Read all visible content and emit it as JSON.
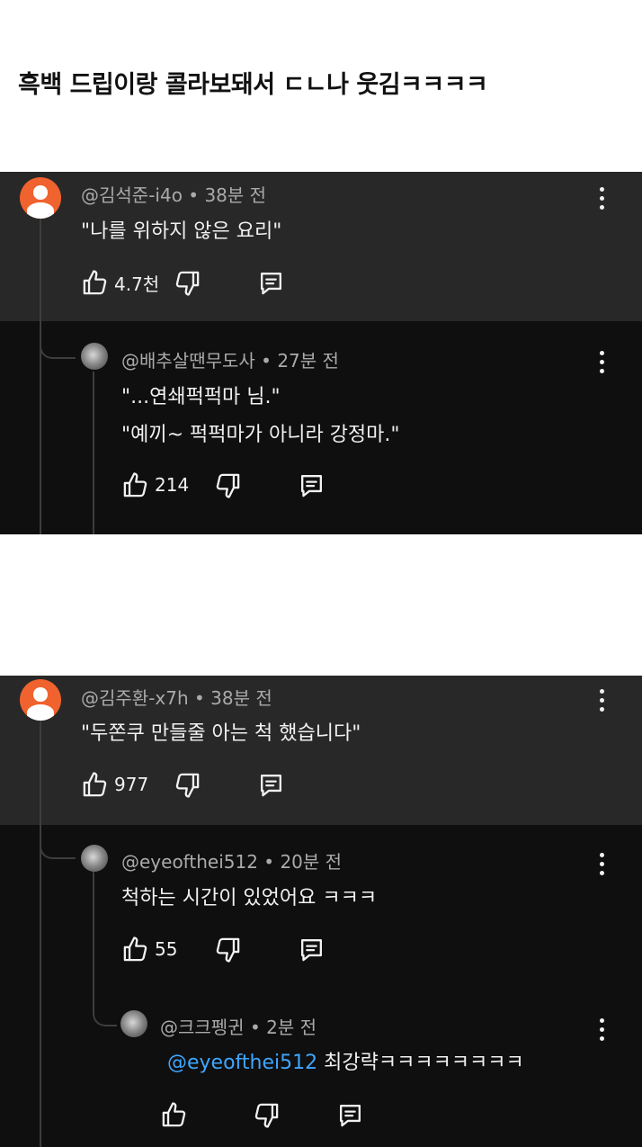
{
  "post": {
    "title": "흑백 드립이랑 콜라보돼서 ㄷㄴ나 웃김ㅋㅋㅋㅋ"
  },
  "shot1": {
    "comment": {
      "author": "@김석준-i4o",
      "time": "38분 전",
      "text": "\"나를 위하지 않은 요리\"",
      "likes": "4.7천"
    },
    "reply": {
      "author": "@배추살땐무도사",
      "time": "27분 전",
      "line1": "\"...연쇄퍽퍽마 님.\"",
      "line2": "\"예끼~ 퍽퍽마가 아니라 강정마.\"",
      "likes": "214"
    }
  },
  "shot2": {
    "comment": {
      "author": "@김주환-x7h",
      "time": "38분 전",
      "text": "\"두쫀쿠 만들줄 아는 척 했습니다\"",
      "likes": "977"
    },
    "reply1": {
      "author": "@eyeofthei512",
      "time": "20분 전",
      "text": "척하는 시간이 있었어요 ㅋㅋㅋ",
      "likes": "55"
    },
    "reply2": {
      "author": "@크크펭귄",
      "time": "2분 전",
      "mention": "@eyeofthei512",
      "text": "최강략ㅋㅋㅋㅋㅋㅋㅋㅋ",
      "likes": ""
    }
  },
  "ui": {
    "separator": "•"
  },
  "icons": [
    "thumbs-up-icon",
    "thumbs-down-icon",
    "reply-icon",
    "more-options-icon",
    "default-avatar-icon"
  ],
  "colors": {
    "background": "#0f0f0f",
    "parent_background": "#282828",
    "text": "#f1f1f1",
    "meta": "#aaaaaa",
    "mention": "#3ea6ff",
    "avatar": "#f0622e"
  }
}
